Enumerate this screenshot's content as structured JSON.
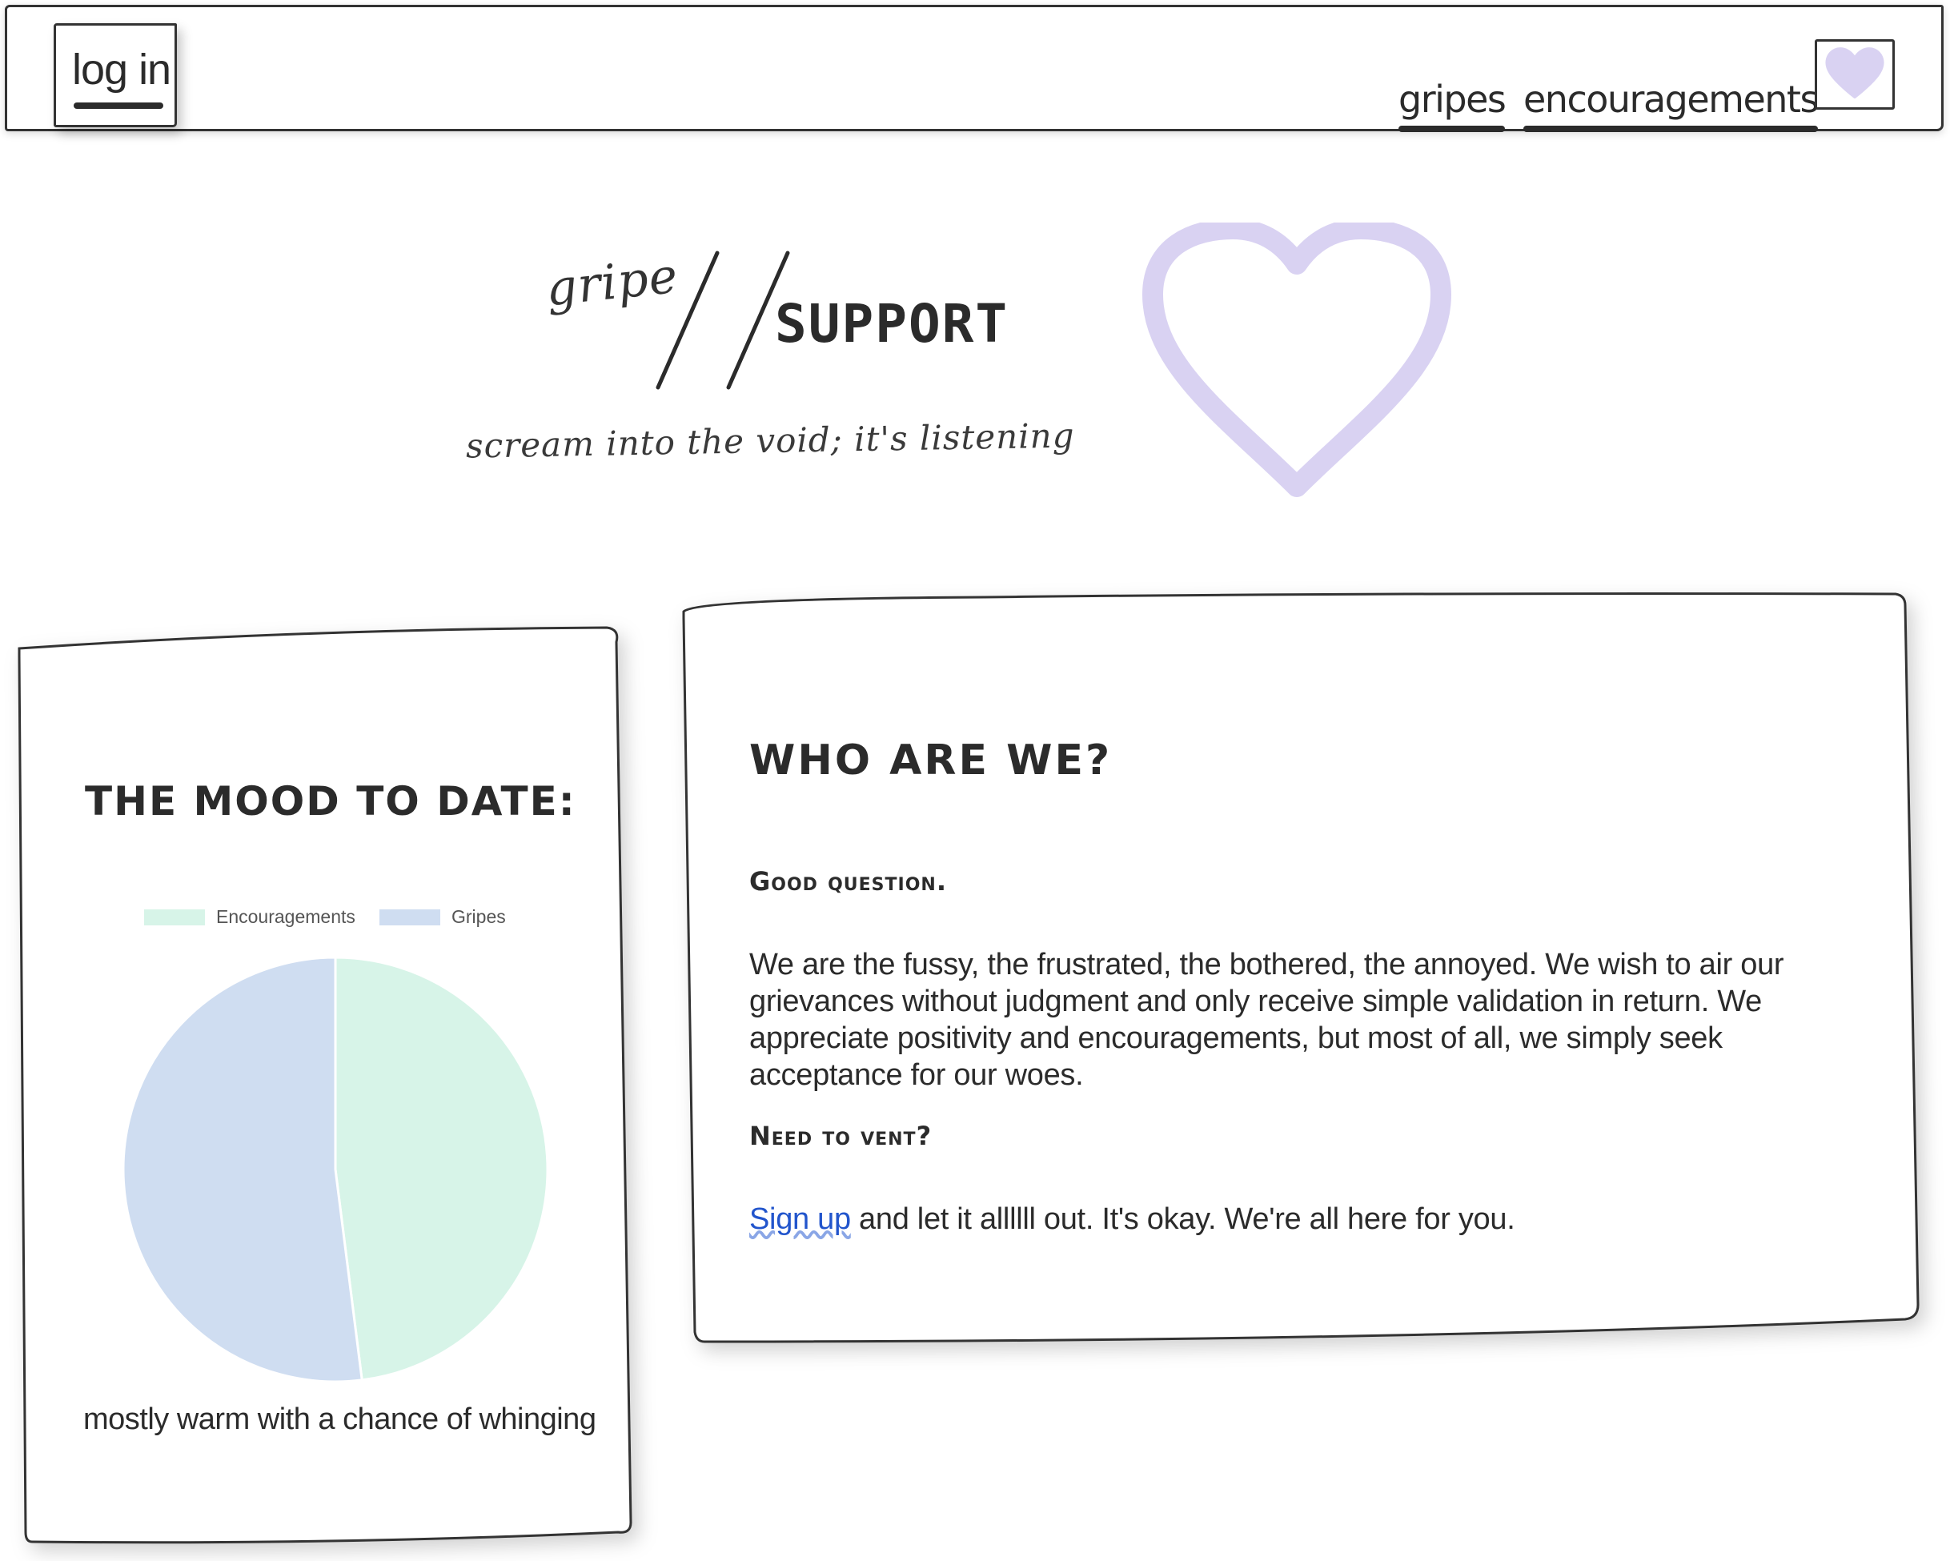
{
  "nav": {
    "login_label": "log in",
    "links": [
      {
        "label": "gripes"
      },
      {
        "label": "encouragements"
      }
    ],
    "avatar_icon": "heart-icon"
  },
  "hero": {
    "logo_left": "gripe",
    "logo_right": "SUPPORT",
    "tagline": "scream into the void; it's listening",
    "heart_icon": "heart-outline-icon"
  },
  "colors": {
    "heart_accent": "#d9d2f2",
    "encouragements": "#d7f4e8",
    "gripes": "#cfddf1",
    "link": "#2255cc"
  },
  "mood": {
    "title": "THE MOOD TO DATE:",
    "caption": "mostly warm with a chance of whinging"
  },
  "chart_data": {
    "type": "pie",
    "labels": [
      "Encouragements",
      "Gripes"
    ],
    "values": [
      48,
      52
    ],
    "colors": [
      "#d7f4e8",
      "#cfddf1"
    ],
    "legend": "top"
  },
  "about": {
    "title": "WHO ARE WE?",
    "subtitle1": "Good question.",
    "body": "We are the fussy, the frustrated, the bothered, the annoyed. We wish to air our grievances without judgment and only receive simple validation in return. We appreciate positivity and encouragements, but most of all, we simply seek acceptance for our woes.",
    "subtitle2": "Need to vent?",
    "signup_label": "Sign up",
    "cta_rest": " and let it allllll out. It's okay. We're all here for you."
  }
}
